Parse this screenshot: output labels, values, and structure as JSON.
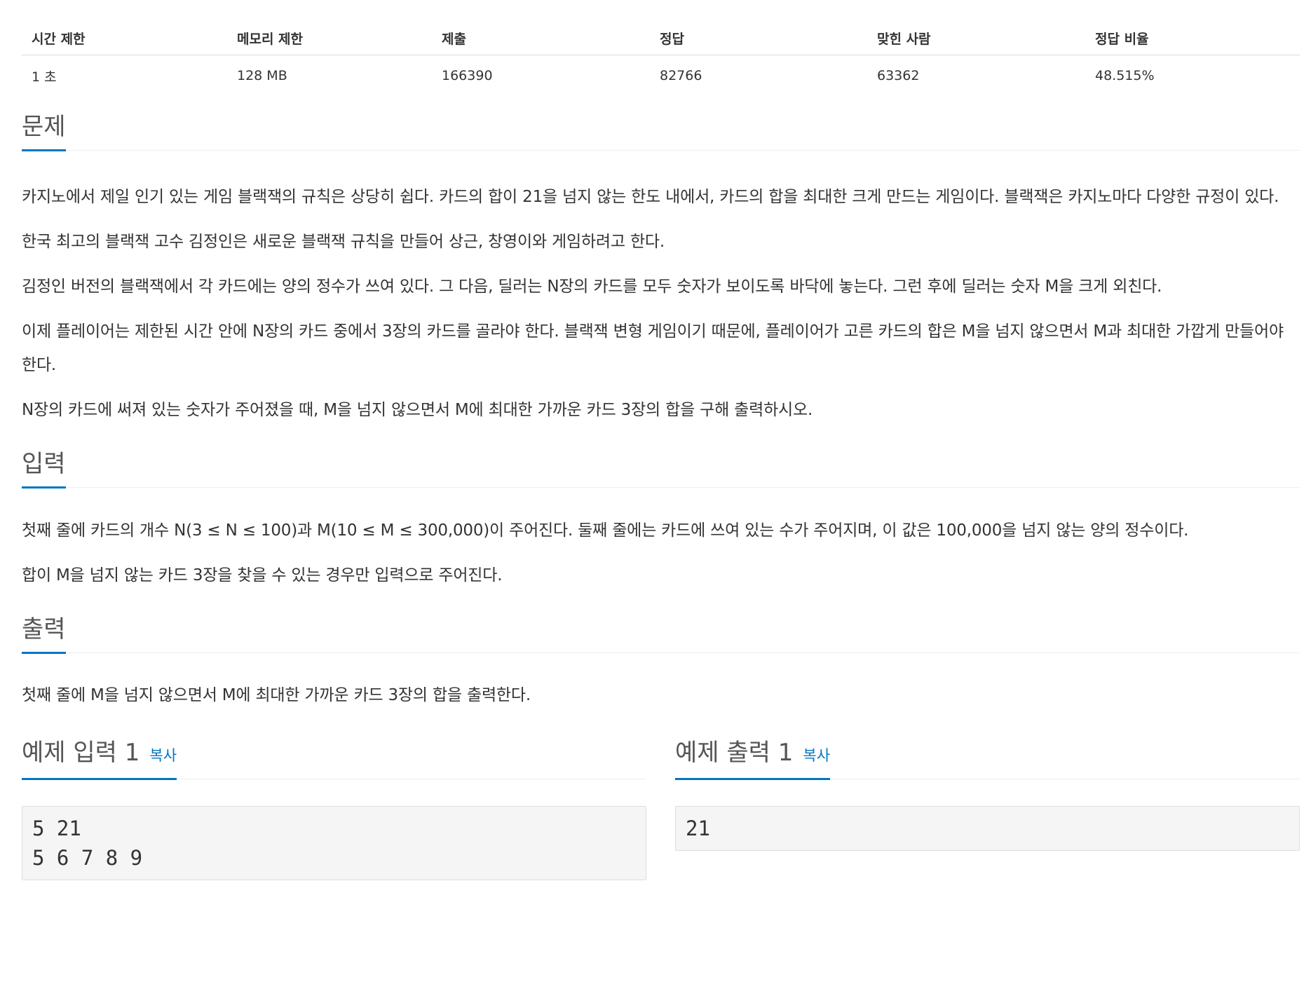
{
  "stats": {
    "headers": [
      "시간 제한",
      "메모리 제한",
      "제출",
      "정답",
      "맞힌 사람",
      "정답 비율"
    ],
    "values": [
      "1 초",
      "128 MB",
      "166390",
      "82766",
      "63362",
      "48.515%"
    ]
  },
  "problem": {
    "title": "문제",
    "paragraphs": [
      "카지노에서 제일 인기 있는 게임 블랙잭의 규칙은 상당히 쉽다. 카드의 합이 21을 넘지 않는 한도 내에서, 카드의 합을 최대한 크게 만드는 게임이다. 블랙잭은 카지노마다 다양한 규정이 있다.",
      "한국 최고의 블랙잭 고수 김정인은 새로운 블랙잭 규칙을 만들어 상근, 창영이와 게임하려고 한다.",
      "김정인 버전의 블랙잭에서 각 카드에는 양의 정수가 쓰여 있다. 그 다음, 딜러는 N장의 카드를 모두 숫자가 보이도록 바닥에 놓는다. 그런 후에 딜러는 숫자 M을 크게 외친다.",
      "이제 플레이어는 제한된 시간 안에 N장의 카드 중에서 3장의 카드를 골라야 한다. 블랙잭 변형 게임이기 때문에, 플레이어가 고른 카드의 합은 M을 넘지 않으면서 M과 최대한 가깝게 만들어야 한다.",
      "N장의 카드에 써져 있는 숫자가 주어졌을 때, M을 넘지 않으면서 M에 최대한 가까운 카드 3장의 합을 구해 출력하시오."
    ]
  },
  "input": {
    "title": "입력",
    "paragraphs": [
      "첫째 줄에 카드의 개수 N(3 ≤ N ≤ 100)과 M(10 ≤ M ≤ 300,000)이 주어진다. 둘째 줄에는 카드에 쓰여 있는 수가 주어지며, 이 값은 100,000을 넘지 않는 양의 정수이다.",
      "합이 M을 넘지 않는 카드 3장을 찾을 수 있는 경우만 입력으로 주어진다."
    ]
  },
  "output": {
    "title": "출력",
    "paragraphs": [
      "첫째 줄에 M을 넘지 않으면서 M에 최대한 가까운 카드 3장의 합을 출력한다."
    ]
  },
  "sample_input": {
    "title": "예제 입력 1",
    "copy_label": "복사",
    "content": "5 21\n5 6 7 8 9"
  },
  "sample_output": {
    "title": "예제 출력 1",
    "copy_label": "복사",
    "content": "21"
  },
  "colors": {
    "accent": "#0076c0",
    "text": "#333333",
    "heading": "#555555",
    "pre_background": "#f5f5f5",
    "border": "#dddddd"
  }
}
